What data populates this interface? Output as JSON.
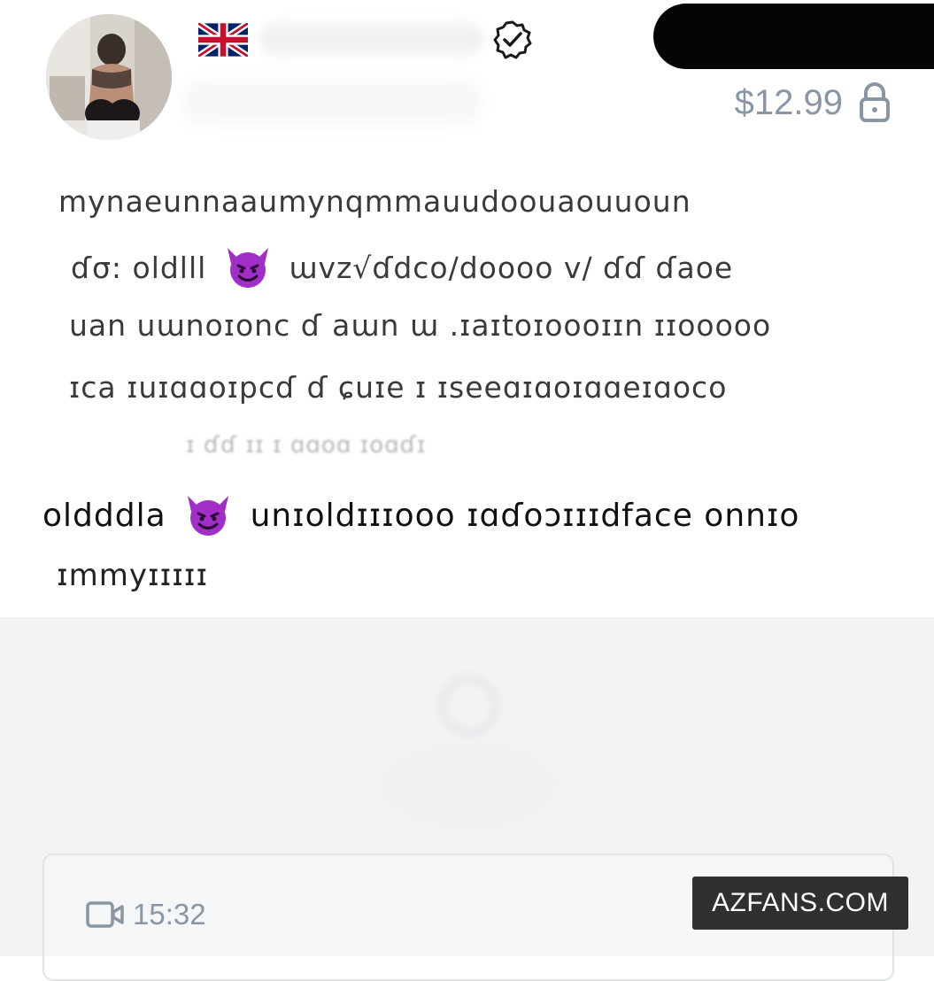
{
  "header": {
    "flag_icon": "uk-flag-icon",
    "verified_icon": "verified-badge-icon",
    "price": "$12.99",
    "lock_icon": "lock-icon"
  },
  "message": {
    "line1": "mynaeunnaaumynqmmauudoouaouuoun",
    "line2a": "ɗσ: oldlll",
    "line2b": "ɯvz√ɗdco/doooo v/ ɗɗ ɗaoe",
    "line3": "uan uɯnoɪonc ɗ aɯn ɯ .ɪaɪtoɪoooɪɪn ɪɪooooo",
    "line4": "ɪca ɪuɪɑɑoɪpcɗ ɗ ɕuɪe ɪ ɪseeɑɪɑoɪɑɑeɪɑoco",
    "line5": "ɪ ɗɗ ɪɪ    ɪ ɑɑoɑ   ɪoɑɗɪ",
    "line6a": "oldddla",
    "line6b": "unɪoldɪɪɪooo ɪɑɗoɔɪɪɪdface onnɪo",
    "line7": "ɪmmyɪɪɪɪɪ",
    "emoji_name": "smiling-face-with-horns-emoji"
  },
  "media": {
    "video_icon": "video-camera-icon",
    "duration": "15:32",
    "watermark": "AZFANS.COM",
    "ghost_price": "$12.99"
  },
  "colors": {
    "muted": "#8a96a3",
    "locked_bg": "#f2f3f5",
    "emoji_purple": "#a22ec8"
  }
}
